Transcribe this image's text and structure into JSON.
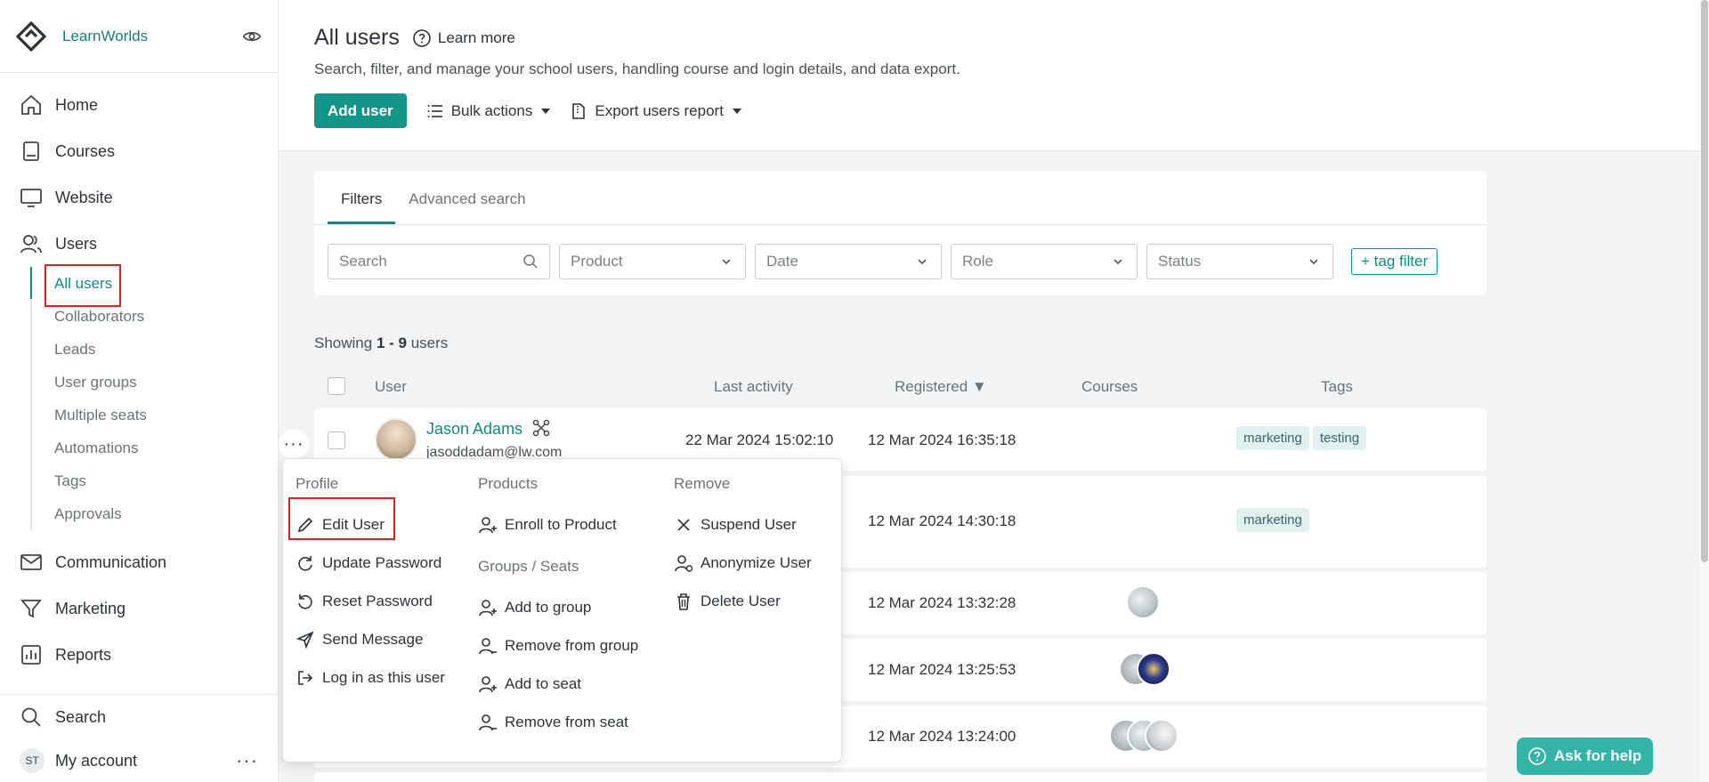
{
  "brand": {
    "name": "LearnWorlds"
  },
  "nav": {
    "home": "Home",
    "courses": "Courses",
    "website": "Website",
    "users": "Users",
    "communication": "Communication",
    "marketing": "Marketing",
    "reports": "Reports",
    "search": "Search",
    "my_account": "My account",
    "account_initials": "ST"
  },
  "subnav": [
    "All users",
    "Collaborators",
    "Leads",
    "User groups",
    "Multiple seats",
    "Automations",
    "Tags",
    "Approvals"
  ],
  "header": {
    "title": "All users",
    "learn_more": "Learn more",
    "subtitle": "Search, filter, and manage your school users, handling course and login details, and data export.",
    "add_user": "Add user",
    "bulk_actions": "Bulk actions",
    "export_report": "Export users report"
  },
  "filters": {
    "tab_filters": "Filters",
    "tab_advanced": "Advanced search",
    "search_placeholder": "Search",
    "product": "Product",
    "date": "Date",
    "role": "Role",
    "status": "Status",
    "tag_filter": "+ tag filter"
  },
  "table": {
    "showing_prefix": "Showing ",
    "showing_range": "1 - 9",
    "showing_suffix": " users",
    "col_user": "User",
    "col_last_activity": "Last activity",
    "col_registered": "Registered ▼",
    "col_courses": "Courses",
    "col_tags": "Tags",
    "rows": [
      {
        "name": "Jason Adams",
        "email": "jasoddadam@lw.com",
        "last_activity": "22 Mar 2024 15:02:10",
        "registered": "12 Mar 2024 16:35:18",
        "tags": [
          "marketing",
          "testing"
        ]
      },
      {
        "registered": "12 Mar 2024 14:30:18",
        "tags": [
          "marketing"
        ]
      },
      {
        "registered": "12 Mar 2024 13:32:28"
      },
      {
        "registered": "12 Mar 2024 13:25:53"
      },
      {
        "registered": "12 Mar 2024 13:24:00"
      }
    ]
  },
  "menu": {
    "profile_header": "Profile",
    "edit_user": "Edit User",
    "update_password": "Update Password",
    "reset_password": "Reset Password",
    "send_message": "Send Message",
    "login_as": "Log in as this user",
    "products_header": "Products",
    "enroll": "Enroll to Product",
    "groups_header": "Groups / Seats",
    "add_group": "Add to group",
    "remove_group": "Remove from group",
    "add_seat": "Add to seat",
    "remove_seat": "Remove from seat",
    "remove_header": "Remove",
    "suspend": "Suspend User",
    "anonymize": "Anonymize User",
    "delete": "Delete User"
  },
  "help": {
    "label": "Ask for help"
  },
  "colors": {
    "accent": "#159488",
    "highlight": "#e11d1d"
  }
}
